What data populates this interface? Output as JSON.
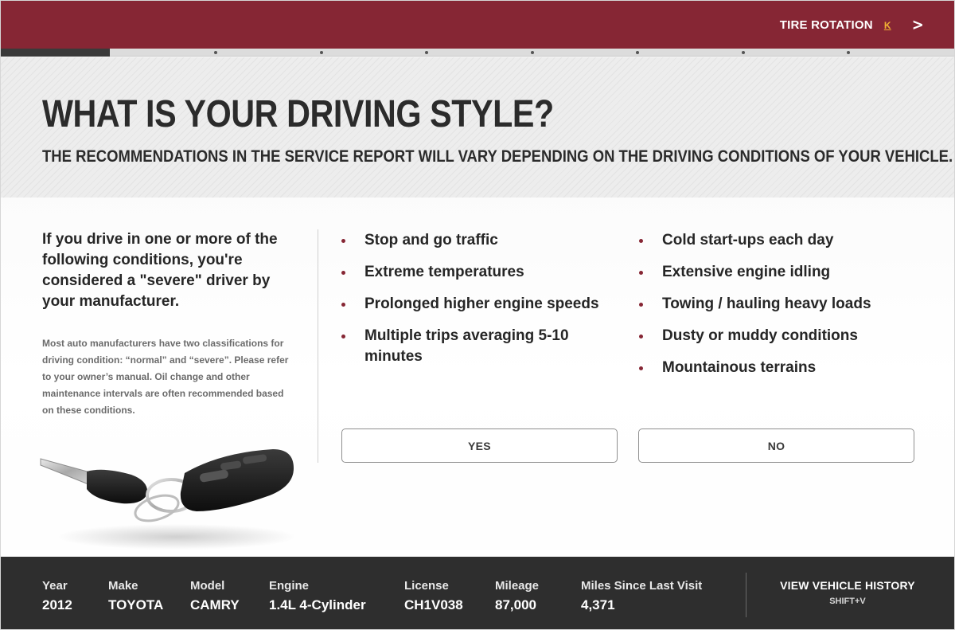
{
  "header": {
    "next_label": "TIRE ROTATION",
    "next_hotkey": "K",
    "next_arrow": ">"
  },
  "progress": {
    "completed_fraction": 0.114,
    "step_count": 9
  },
  "hero": {
    "title": "WHAT IS YOUR DRIVING STYLE?",
    "subtitle": "THE RECOMMENDATIONS IN THE SERVICE REPORT WILL VARY DEPENDING ON THE DRIVING CONDITIONS OF YOUR VEHICLE."
  },
  "intro": {
    "text": "If you drive in one or more of the following conditions, you're considered a \"severe\" driver by your manufacturer.",
    "note": "Most auto manufacturers have two classifications for driving condition: “normal” and “severe”. Please refer to your owner’s manual. Oil change and other maintenance intervals are often recommended based on these conditions."
  },
  "conditions_left": [
    "Stop and go traffic",
    "Extreme temperatures",
    "Prolonged higher engine speeds",
    "Multiple trips averaging 5-10 minutes"
  ],
  "conditions_right": [
    "Cold start-ups each day",
    "Extensive engine idling",
    "Towing / hauling heavy loads",
    "Dusty or muddy conditions",
    "Mountainous terrains"
  ],
  "buttons": {
    "yes": "YES",
    "no": "NO"
  },
  "vehicle": {
    "year_label": "Year",
    "year": "2012",
    "make_label": "Make",
    "make": "TOYOTA",
    "model_label": "Model",
    "model": "CAMRY",
    "engine_label": "Engine",
    "engine": "1.4L 4-Cylinder",
    "license_label": "License",
    "license": "CH1V038",
    "mileage_label": "Mileage",
    "mileage": "87,000",
    "since_label": "Miles Since Last Visit",
    "since": "4,371"
  },
  "history": {
    "label": "VIEW VEHICLE HISTORY",
    "shortcut": "SHIFT+V"
  },
  "colors": {
    "brand": "#862634",
    "footer": "#2e2e2e",
    "hotkey": "#f2b233"
  }
}
